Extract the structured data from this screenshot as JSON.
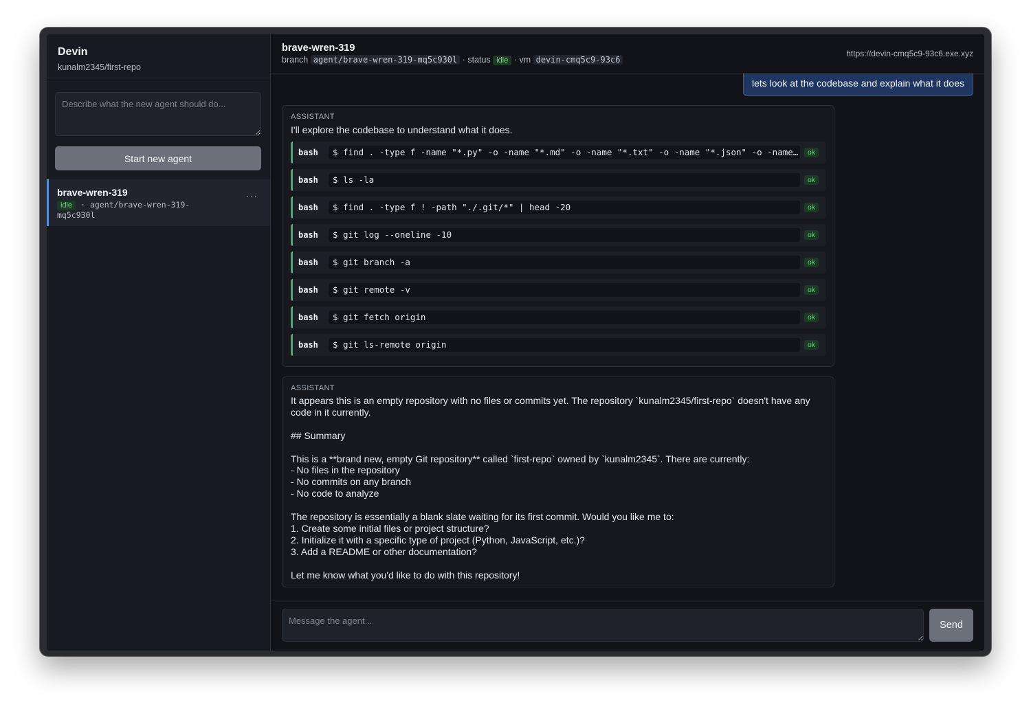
{
  "sidebar": {
    "app_name": "Devin",
    "repo": "kunalm2345/first-repo",
    "new_agent_placeholder": "Describe what the new agent should do...",
    "start_button": "Start new agent",
    "agents": [
      {
        "name": "brave-wren-319",
        "status": "idle",
        "separator": "·",
        "branch": "agent/brave-wren-319-mq5c930l",
        "more": "···"
      }
    ]
  },
  "header": {
    "agent_name": "brave-wren-319",
    "branch_label": "branch",
    "branch": "agent/brave-wren-319-mq5c930l",
    "status_label": "· status",
    "status": "idle",
    "vm_label": "· vm",
    "vm": "devin-cmq5c9-93c6",
    "url": "https://devin-cmq5c9-93c6.exe.xyz"
  },
  "conversation": {
    "user_message": "lets look at the codebase and explain what it does",
    "assistant1": {
      "role": "ASSISTANT",
      "text": "I'll explore the codebase to understand what it does.",
      "tool_calls": [
        {
          "tool": "bash",
          "command": "$ find . -type f -name \"*.py\" -o -name \"*.md\" -o -name \"*.txt\" -o -name \"*.json\" -o -name \"*.js\" -o -name \"*.ts\"",
          "status": "ok"
        },
        {
          "tool": "bash",
          "command": "$ ls -la",
          "status": "ok"
        },
        {
          "tool": "bash",
          "command": "$ find . -type f ! -path \"./.git/*\" | head -20",
          "status": "ok"
        },
        {
          "tool": "bash",
          "command": "$ git log --oneline -10",
          "status": "ok"
        },
        {
          "tool": "bash",
          "command": "$ git branch -a",
          "status": "ok"
        },
        {
          "tool": "bash",
          "command": "$ git remote -v",
          "status": "ok"
        },
        {
          "tool": "bash",
          "command": "$ git fetch origin",
          "status": "ok"
        },
        {
          "tool": "bash",
          "command": "$ git ls-remote origin",
          "status": "ok"
        }
      ]
    },
    "assistant2": {
      "role": "ASSISTANT",
      "text": "It appears this is an empty repository with no files or commits yet. The repository `kunalm2345/first-repo` doesn't have any code in it currently.\n\n## Summary\n\nThis is a **brand new, empty Git repository** called `first-repo` owned by `kunalm2345`. There are currently:\n- No files in the repository\n- No commits on any branch\n- No code to analyze\n\nThe repository is essentially a blank slate waiting for its first commit. Would you like me to:\n1. Create some initial files or project structure?\n2. Initialize it with a specific type of project (Python, JavaScript, etc.)?\n3. Add a README or other documentation?\n\nLet me know what you'd like to do with this repository!"
    }
  },
  "composer": {
    "placeholder": "Message the agent...",
    "send_label": "Send"
  },
  "colors": {
    "accent_green": "#3fb26a",
    "status_green": "#6fd685",
    "user_bubble": "#1f3660",
    "selected_agent_border": "#5a8fd6"
  }
}
